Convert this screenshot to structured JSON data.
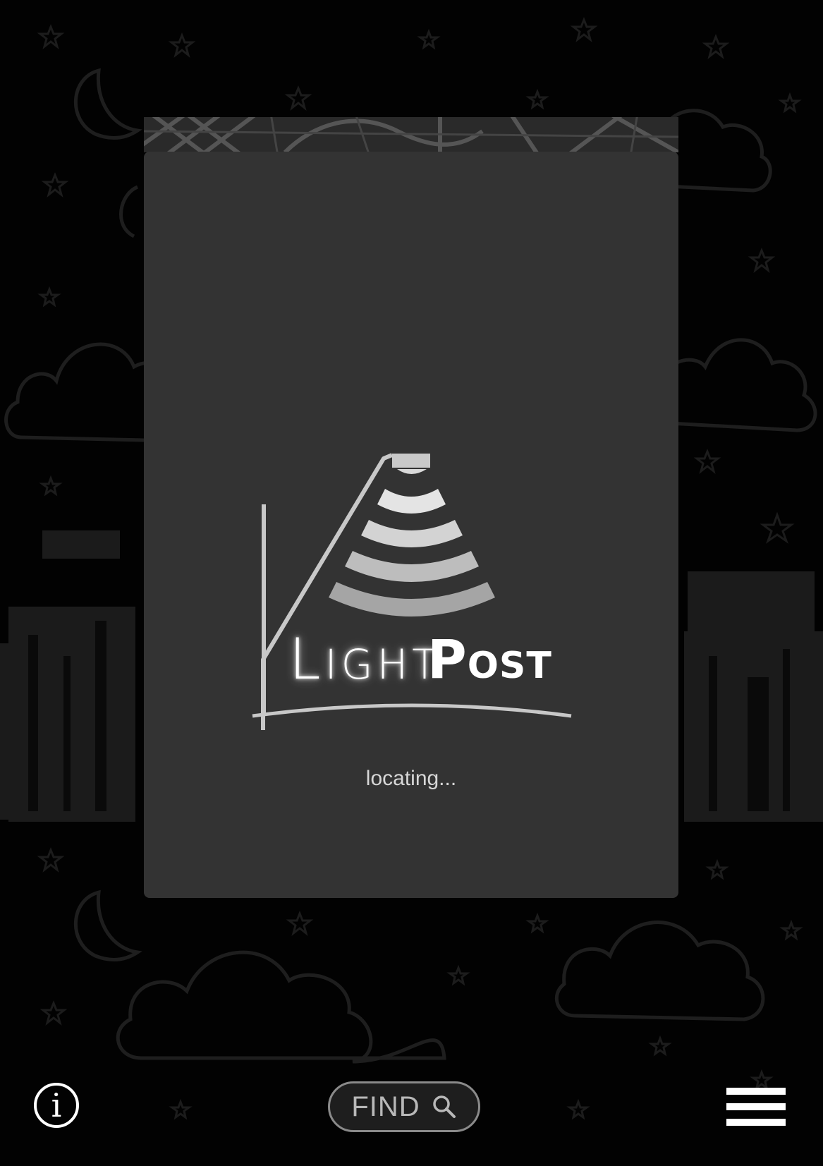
{
  "app": {
    "name_part_1": "LIGHT",
    "name_part_2": "POST",
    "status_text": "locating..."
  },
  "nav": {
    "find_label": "FIND",
    "info_glyph": "i",
    "find_icon": "search-icon",
    "menu_icon": "hamburger-menu-icon"
  },
  "colors": {
    "background": "#020202",
    "modal": "#333333",
    "text": "#ffffff",
    "muted_text": "#d7d7d7"
  }
}
